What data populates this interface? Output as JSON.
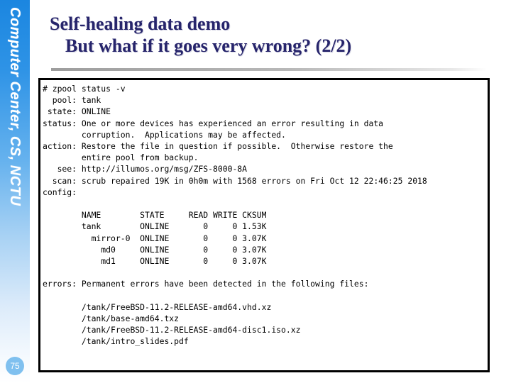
{
  "sidebar": {
    "brand": "Computer Center, CS, NCTU",
    "page_number": "75",
    "badge_color": "#7fc0ef",
    "gradient_top": "#1b86e0",
    "gradient_bottom": "#ffffff"
  },
  "title": {
    "line1": "Self-healing data demo",
    "line2": "But what if it goes very wrong? (2/2)",
    "color": "#26246b"
  },
  "terminal": {
    "prompt_line": "# zpool status -v",
    "fields": {
      "pool_label": "pool:",
      "pool_value": "tank",
      "state_label": "state:",
      "state_value": "ONLINE",
      "status_label": "status:",
      "status_value_l1": "One or more devices has experienced an error resulting in data",
      "status_value_l2": "corruption.  Applications may be affected.",
      "action_label": "action:",
      "action_value_l1": "Restore the file in question if possible.  Otherwise restore the",
      "action_value_l2": "entire pool from backup.",
      "see_label": "see:",
      "see_value": "http://illumos.org/msg/ZFS-8000-8A",
      "scan_label": "scan:",
      "scan_value": "scrub repaired 19K in 0h0m with 1568 errors on Fri Oct 12 22:46:25 2018",
      "config_label": "config:",
      "errors_label": "errors:",
      "errors_value": "Permanent errors have been detected in the following files:"
    },
    "table": {
      "headers": [
        "NAME",
        "STATE",
        "READ",
        "WRITE",
        "CKSUM"
      ],
      "rows": [
        {
          "name": "tank",
          "indent": 0,
          "state": "ONLINE",
          "read": "0",
          "write": "0",
          "cksum": "1.53K"
        },
        {
          "name": "mirror-0",
          "indent": 2,
          "state": "ONLINE",
          "read": "0",
          "write": "0",
          "cksum": "3.07K"
        },
        {
          "name": "md0",
          "indent": 4,
          "state": "ONLINE",
          "read": "0",
          "write": "0",
          "cksum": "3.07K"
        },
        {
          "name": "md1",
          "indent": 4,
          "state": "ONLINE",
          "read": "0",
          "write": "0",
          "cksum": "3.07K"
        }
      ]
    },
    "error_files": [
      "/tank/FreeBSD-11.2-RELEASE-amd64.vhd.xz",
      "/tank/base-amd64.txz",
      "/tank/FreeBSD-11.2-RELEASE-amd64-disc1.iso.xz",
      "/tank/intro_slides.pdf"
    ],
    "full_text": "# zpool status -v\n  pool: tank\n state: ONLINE\nstatus: One or more devices has experienced an error resulting in data\n        corruption.  Applications may be affected.\naction: Restore the file in question if possible.  Otherwise restore the\n        entire pool from backup.\n   see: http://illumos.org/msg/ZFS-8000-8A\n  scan: scrub repaired 19K in 0h0m with 1568 errors on Fri Oct 12 22:46:25 2018\nconfig:\n\n        NAME        STATE     READ WRITE CKSUM\n        tank        ONLINE       0     0 1.53K\n          mirror-0  ONLINE       0     0 3.07K\n            md0     ONLINE       0     0 3.07K\n            md1     ONLINE       0     0 3.07K\n\nerrors: Permanent errors have been detected in the following files:\n\n        /tank/FreeBSD-11.2-RELEASE-amd64.vhd.xz\n        /tank/base-amd64.txz\n        /tank/FreeBSD-11.2-RELEASE-amd64-disc1.iso.xz\n        /tank/intro_slides.pdf"
  }
}
